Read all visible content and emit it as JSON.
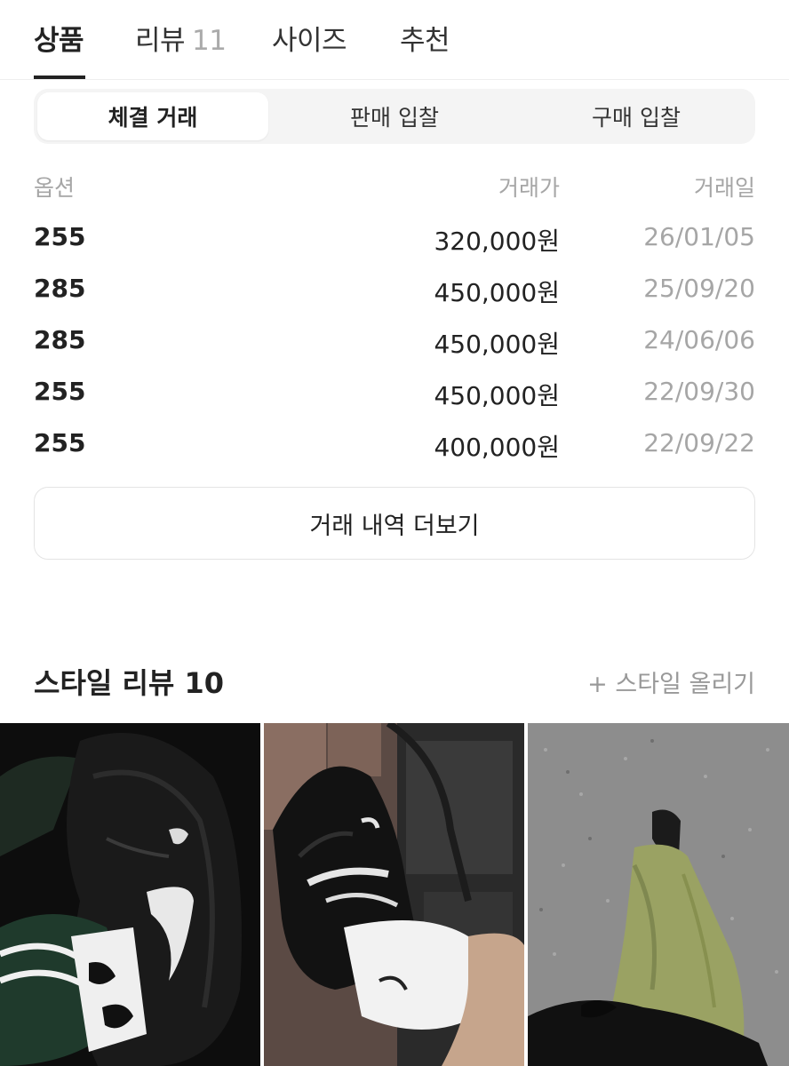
{
  "tabs": [
    {
      "label": "상품",
      "count": ""
    },
    {
      "label": "리뷰",
      "count": "11"
    },
    {
      "label": "사이즈",
      "count": ""
    },
    {
      "label": "추천",
      "count": ""
    }
  ],
  "segment": [
    "체결 거래",
    "판매 입찰",
    "구매 입찰"
  ],
  "table": {
    "headers": {
      "option": "옵션",
      "price": "거래가",
      "date": "거래일"
    },
    "rows": [
      {
        "option": "255",
        "price": "320,000원",
        "date": "26/01/05"
      },
      {
        "option": "285",
        "price": "450,000원",
        "date": "25/09/20"
      },
      {
        "option": "285",
        "price": "450,000원",
        "date": "24/06/06"
      },
      {
        "option": "255",
        "price": "450,000원",
        "date": "22/09/30"
      },
      {
        "option": "255",
        "price": "400,000원",
        "date": "22/09/22"
      }
    ]
  },
  "more_button": "거래 내역 더보기",
  "style_review": {
    "title": "스타일 리뷰 10",
    "upload": "+ 스타일 올리기"
  },
  "colors": {
    "text_primary": "#222222",
    "text_muted": "#a6a6a6",
    "segment_bg": "#f4f4f4"
  }
}
